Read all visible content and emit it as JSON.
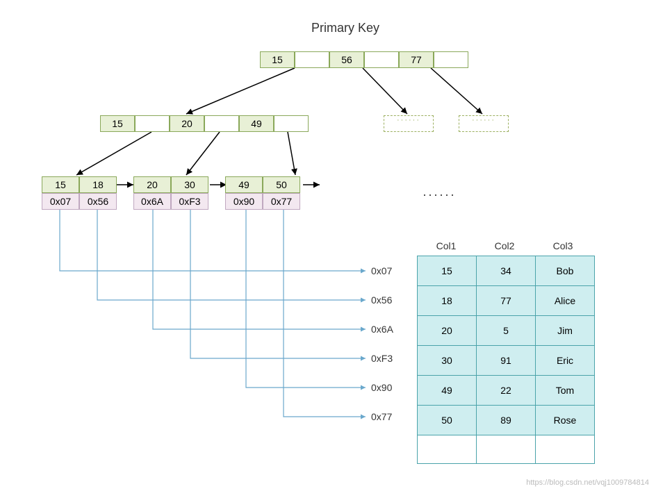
{
  "title": "Primary Key",
  "rootKeys": [
    "15",
    "56",
    "77"
  ],
  "internalKeys": [
    "15",
    "20",
    "49"
  ],
  "ghostPlaceholder": "······",
  "leaves": [
    {
      "keys": [
        "15",
        "18"
      ],
      "ptrs": [
        "0x07",
        "0x56"
      ]
    },
    {
      "keys": [
        "20",
        "30"
      ],
      "ptrs": [
        "0x6A",
        "0xF3"
      ]
    },
    {
      "keys": [
        "49",
        "50"
      ],
      "ptrs": [
        "0x90",
        "0x77"
      ]
    }
  ],
  "pointerLabels": [
    "0x07",
    "0x56",
    "0x6A",
    "0xF3",
    "0x90",
    "0x77"
  ],
  "dotsLabel": "······",
  "columns": [
    "Col1",
    "Col2",
    "Col3"
  ],
  "rows": [
    {
      "c1": "15",
      "c2": "34",
      "c3": "Bob"
    },
    {
      "c1": "18",
      "c2": "77",
      "c3": "Alice"
    },
    {
      "c1": "20",
      "c2": "5",
      "c3": "Jim"
    },
    {
      "c1": "30",
      "c2": "91",
      "c3": "Eric"
    },
    {
      "c1": "49",
      "c2": "22",
      "c3": "Tom"
    },
    {
      "c1": "50",
      "c2": "89",
      "c3": "Rose"
    }
  ],
  "watermark": "https://blog.csdn.net/vqj1009784814",
  "chart_data": {
    "type": "table",
    "title": "Primary Key",
    "description": "B+tree index with clustered data table",
    "root": {
      "keys": [
        15,
        56,
        77
      ]
    },
    "internal": [
      {
        "keys": [
          15,
          20,
          49
        ]
      }
    ],
    "leaves": [
      {
        "keys": [
          15,
          18
        ],
        "pointers": [
          "0x07",
          "0x56"
        ]
      },
      {
        "keys": [
          20,
          30
        ],
        "pointers": [
          "0x6A",
          "0xF3"
        ]
      },
      {
        "keys": [
          49,
          50
        ],
        "pointers": [
          "0x90",
          "0x77"
        ]
      }
    ],
    "columns": [
      "Col1",
      "Col2",
      "Col3"
    ],
    "data": [
      {
        "ptr": "0x07",
        "Col1": 15,
        "Col2": 34,
        "Col3": "Bob"
      },
      {
        "ptr": "0x56",
        "Col1": 18,
        "Col2": 77,
        "Col3": "Alice"
      },
      {
        "ptr": "0x6A",
        "Col1": 20,
        "Col2": 5,
        "Col3": "Jim"
      },
      {
        "ptr": "0xF3",
        "Col1": 30,
        "Col2": 91,
        "Col3": "Eric"
      },
      {
        "ptr": "0x90",
        "Col1": 49,
        "Col2": 22,
        "Col3": "Tom"
      },
      {
        "ptr": "0x77",
        "Col1": 50,
        "Col2": 89,
        "Col3": "Rose"
      }
    ]
  }
}
